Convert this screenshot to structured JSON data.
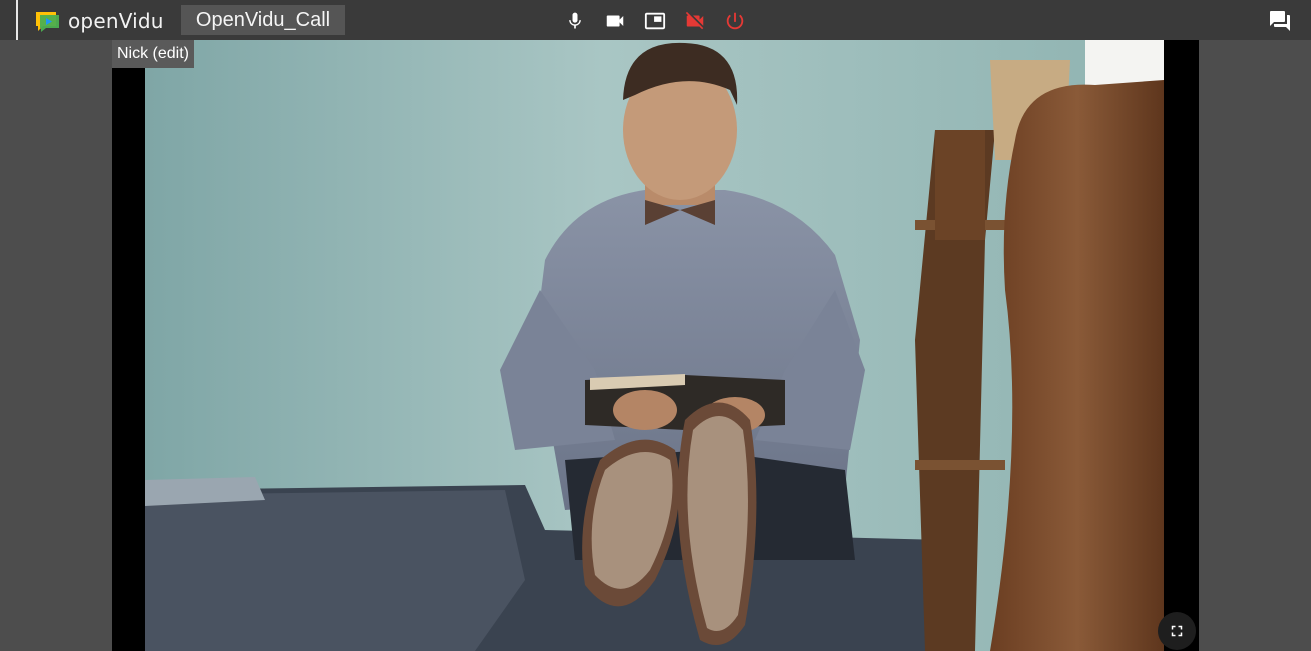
{
  "app": {
    "logo_text": "openVidu",
    "session_title": "OpenVidu_Call"
  },
  "toolbar": {
    "controls": [
      {
        "name": "microphone",
        "icon": "microphone-icon"
      },
      {
        "name": "camera",
        "icon": "videocam-icon"
      },
      {
        "name": "screen-share",
        "icon": "picture-in-picture-icon"
      },
      {
        "name": "camera-off",
        "icon": "videocam-off-icon",
        "color": "#e53935"
      },
      {
        "name": "leave-session",
        "icon": "power-icon",
        "color": "#e53935"
      }
    ],
    "chat_icon": "chat-icon"
  },
  "stream": {
    "nickname": "Nick (edit)",
    "fullscreen_icon": "fullscreen-icon"
  },
  "colors": {
    "toolbar_bg": "#3a3a3a",
    "page_bg": "#4d4d4d",
    "alert_red": "#e53935",
    "logo_green": "#4caf50",
    "logo_yellow": "#ffc107",
    "logo_blue": "#2196f3"
  }
}
